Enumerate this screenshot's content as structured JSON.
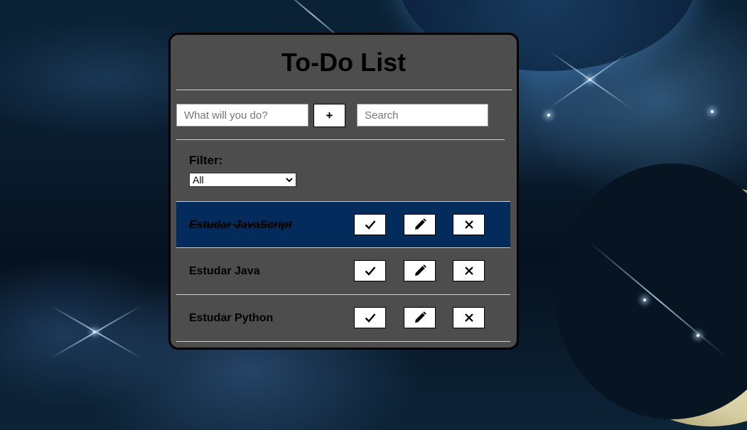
{
  "app": {
    "title": "To-Do List"
  },
  "form": {
    "new_todo_placeholder": "What will you do?",
    "new_todo_value": "",
    "add_button_label": "+",
    "search_placeholder": "Search",
    "search_value": ""
  },
  "filter": {
    "label": "Filter:",
    "selected": "All"
  },
  "todos": [
    {
      "text": "Estudar JavaScript",
      "done": true
    },
    {
      "text": "Estudar Java",
      "done": false
    },
    {
      "text": "Estudar Python",
      "done": false
    }
  ],
  "icons": {
    "complete": "check-icon",
    "edit": "pencil-icon",
    "remove": "x-icon"
  },
  "colors": {
    "panel_bg": "#4d4d4d",
    "done_row_bg": "#032c5c",
    "divider": "#cfcfcf"
  }
}
